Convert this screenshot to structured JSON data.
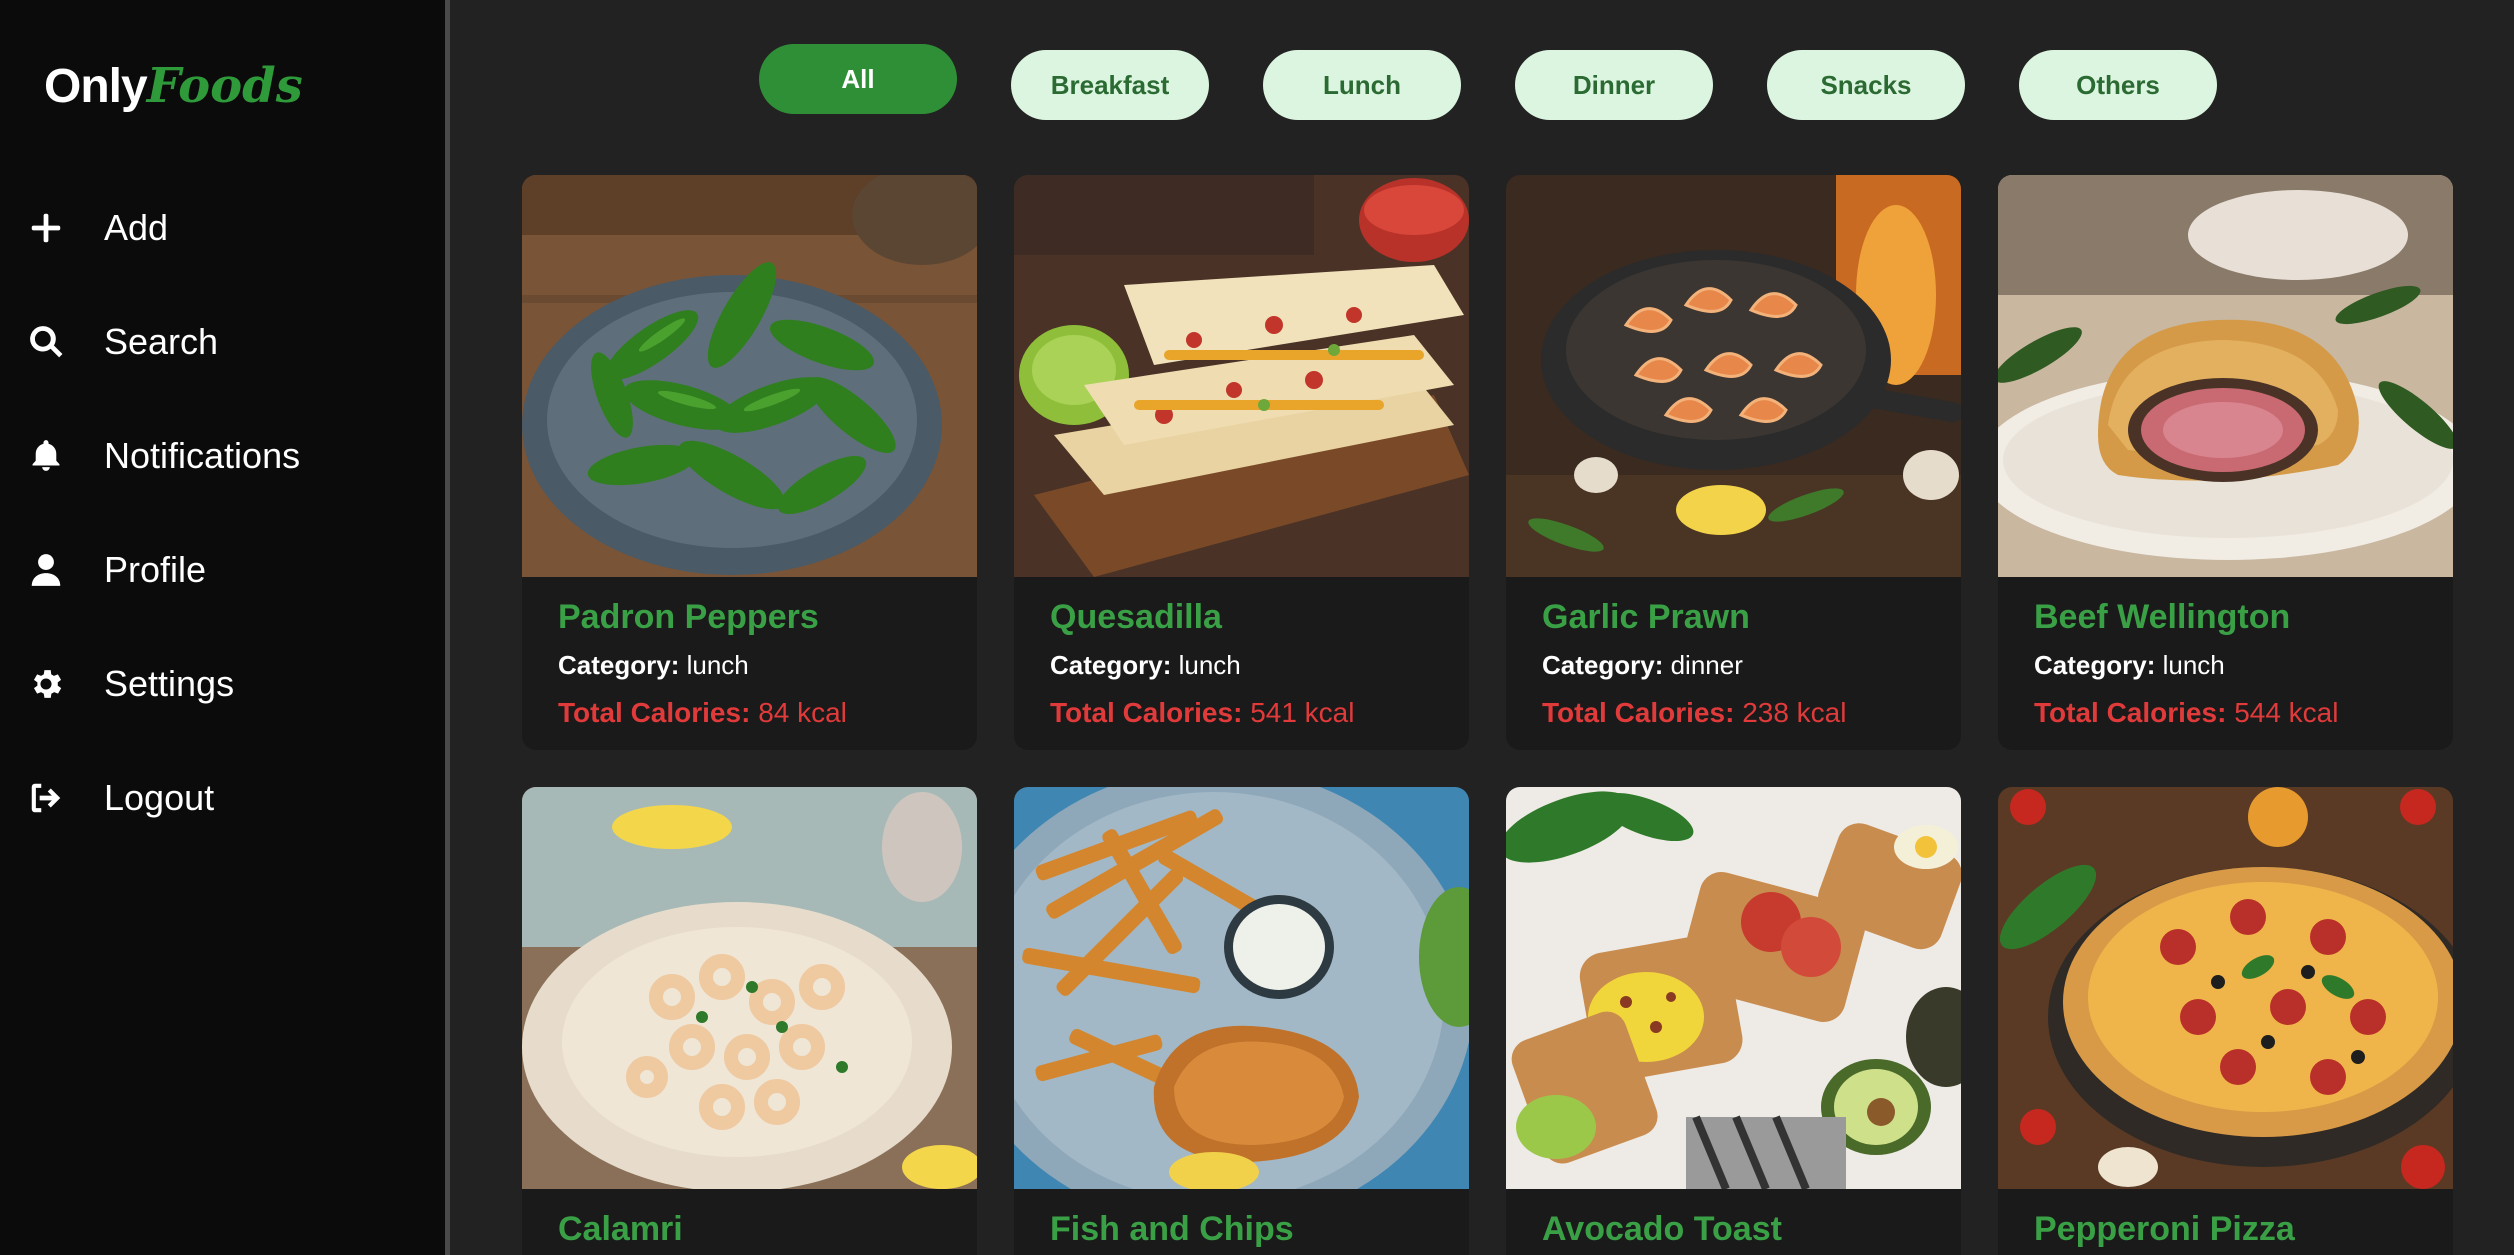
{
  "logo": {
    "part1": "Only",
    "part2": "Foods"
  },
  "nav": [
    {
      "label": "Add",
      "icon": "plus-icon"
    },
    {
      "label": "Search",
      "icon": "search-icon"
    },
    {
      "label": "Notifications",
      "icon": "bell-icon"
    },
    {
      "label": "Profile",
      "icon": "user-icon"
    },
    {
      "label": "Settings",
      "icon": "gear-icon"
    },
    {
      "label": "Logout",
      "icon": "logout-icon"
    }
  ],
  "filters": [
    "All",
    "Breakfast",
    "Lunch",
    "Dinner",
    "Snacks",
    "Others"
  ],
  "active_filter": "All",
  "labels": {
    "category": "Category:",
    "calories": "Total Calories:"
  },
  "foods": [
    {
      "name": "Padron Peppers",
      "category": "lunch",
      "calories": "84 kcal"
    },
    {
      "name": "Quesadilla",
      "category": "lunch",
      "calories": "541 kcal"
    },
    {
      "name": "Garlic Prawn",
      "category": "dinner",
      "calories": "238 kcal"
    },
    {
      "name": "Beef Wellington",
      "category": "lunch",
      "calories": "544 kcal"
    },
    {
      "name": "Calamri"
    },
    {
      "name": "Fish and Chips"
    },
    {
      "name": "Avocado Toast"
    },
    {
      "name": "Pepperoni Pizza"
    }
  ],
  "colors": {
    "accent": "#2f8f37",
    "chip": "#dcf5e0",
    "calories": "#e03a3a",
    "sidebar": "#0b0b0b",
    "background": "#222222"
  }
}
